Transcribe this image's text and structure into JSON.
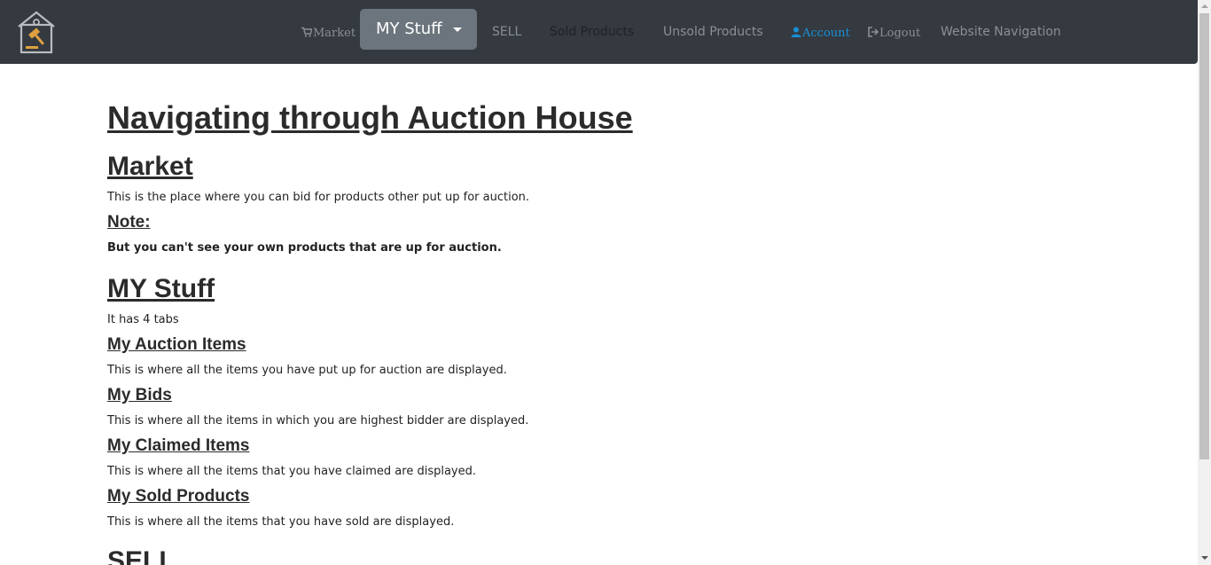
{
  "nav": {
    "market": "Market",
    "my_stuff": "MY Stuff",
    "sell": "SELL",
    "sold_products": "Sold Products",
    "unsold_products": "Unsold Products",
    "account": "Account",
    "logout": "Logout",
    "website_navigation": "Website Navigation",
    "icons": {
      "logo": "auction-house-logo",
      "market": "cart-icon",
      "account": "user-icon",
      "logout": "logout-icon",
      "dropdown": "caret-down-icon"
    },
    "colors": {
      "navbar_bg": "#343a40",
      "active_button": "#6c757d",
      "account_link": "#1a8fd6",
      "logo_accent": "#e0a040"
    }
  },
  "content": {
    "title": "Navigating through Auction House",
    "market": {
      "heading": "Market",
      "text": "This is the place where you can bid for products other put up for auction.",
      "note_heading": "Note:",
      "note_text": "But you can't see your own products that are up for auction."
    },
    "my_stuff": {
      "heading": "MY Stuff",
      "text": "It has 4 tabs",
      "tabs": [
        {
          "heading": "My Auction Items",
          "text": "This is where all the items you have put up for auction are displayed."
        },
        {
          "heading": "My Bids",
          "text": "This is where all the items in which you are highest bidder are displayed."
        },
        {
          "heading": "My Claimed Items",
          "text": "This is where all the items that you have claimed are displayed."
        },
        {
          "heading": "My Sold Products",
          "text": "This is where all the items that you have sold are displayed."
        }
      ]
    },
    "sell": {
      "heading": "SELL"
    }
  }
}
